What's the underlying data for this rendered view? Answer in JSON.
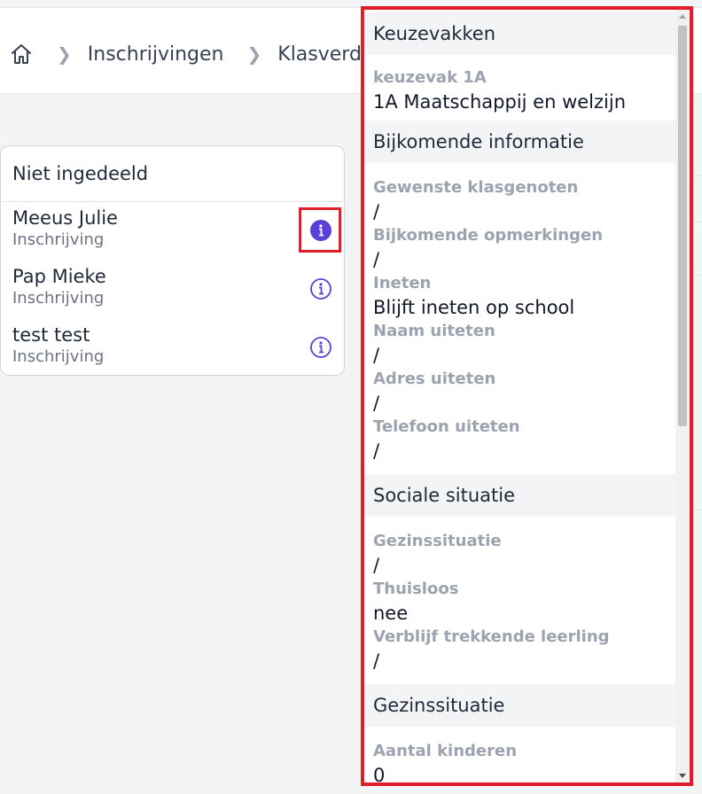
{
  "breadcrumb": {
    "home_icon": "home-icon",
    "items": [
      "Inschrijvingen",
      "Klasverd"
    ]
  },
  "unassigned": {
    "title": "Niet ingedeeld",
    "people": [
      {
        "name": "Meeus Julie",
        "status": "Inschrijving",
        "active": true
      },
      {
        "name": "Pap Mieke",
        "status": "Inschrijving",
        "active": false
      },
      {
        "name": "test test",
        "status": "Inschrijving",
        "active": false
      }
    ]
  },
  "panel": {
    "sections": {
      "keuzevakken": {
        "title": "Keuzevakken",
        "fields": [
          {
            "label": "keuzevak 1A",
            "value": "1A Maatschappij en welzijn"
          }
        ]
      },
      "bijkomende": {
        "title": "Bijkomende informatie",
        "fields": [
          {
            "label": "Gewenste klasgenoten",
            "value": "/"
          },
          {
            "label": "Bijkomende opmerkingen",
            "value": "/"
          },
          {
            "label": "Ineten",
            "value": "Blijft ineten op school"
          },
          {
            "label": "Naam uiteten",
            "value": "/"
          },
          {
            "label": "Adres uiteten",
            "value": "/"
          },
          {
            "label": "Telefoon uiteten",
            "value": "/"
          }
        ]
      },
      "sociale": {
        "title": "Sociale situatie",
        "fields": [
          {
            "label": "Gezinssituatie",
            "value": "/"
          },
          {
            "label": "Thuisloos",
            "value": "nee"
          },
          {
            "label": "Verblijf trekkende leerling",
            "value": "/"
          }
        ]
      },
      "gezin": {
        "title": "Gezinssituatie",
        "fields": [
          {
            "label": "Aantal kinderen",
            "value": "0"
          }
        ]
      }
    }
  },
  "colors": {
    "accent": "#5b3fd6",
    "highlight": "#e11d2a"
  }
}
